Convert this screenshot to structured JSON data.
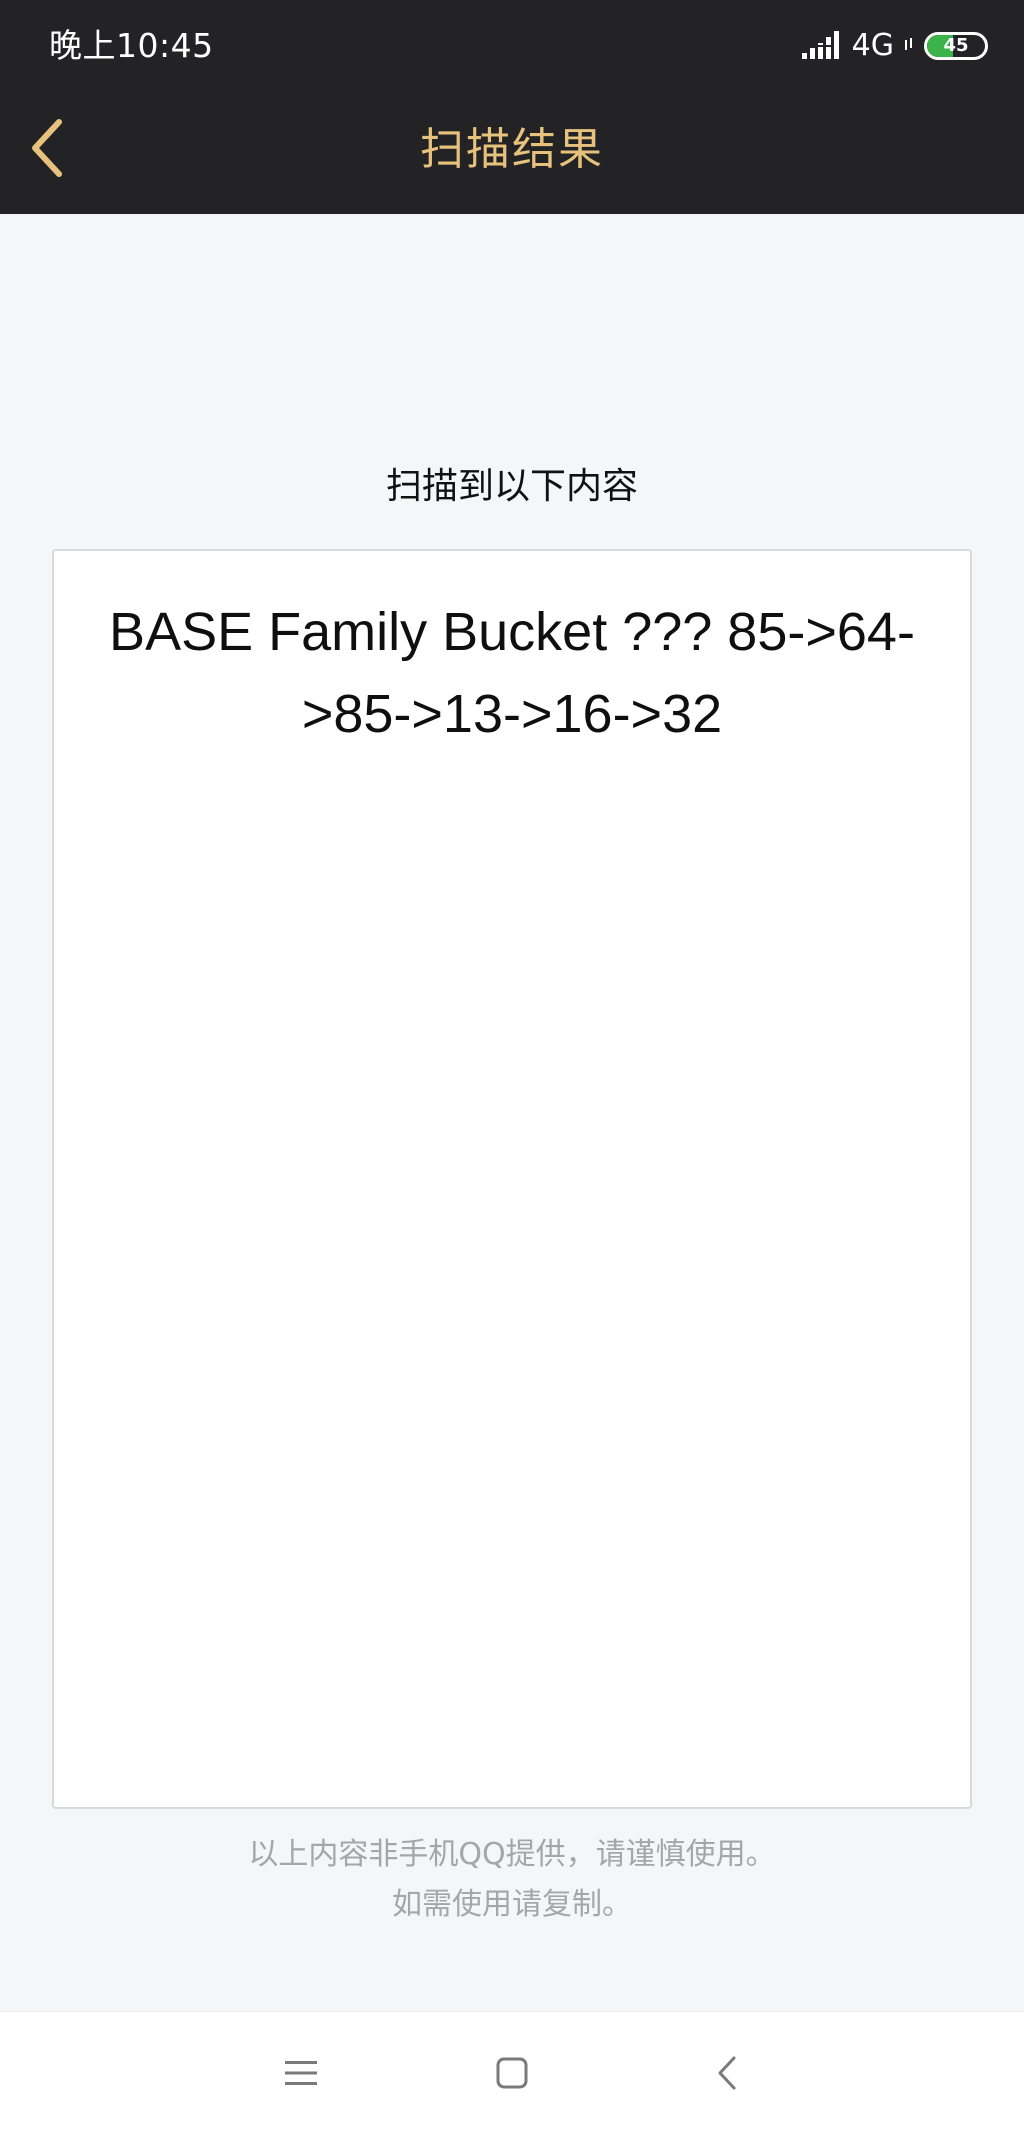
{
  "status_bar": {
    "time": "晚上10:45",
    "network": "4G",
    "battery_level": "45",
    "battery_fraction": 0.45,
    "signal_icon": "signal-icon"
  },
  "header": {
    "title": "扫描结果",
    "back_icon": "chevron-left-icon",
    "title_color": "#e6c27d",
    "background": "#232325"
  },
  "main": {
    "heading": "扫描到以下内容",
    "result_text": "BASE Family Bucket ??? 85->64->85->13->16->32"
  },
  "footer": {
    "notice_line1": "以上内容非手机QQ提供，请谨慎使用。",
    "notice_line2": "如需使用请复制。"
  },
  "system_nav": {
    "menu_icon": "menu-icon",
    "home_icon": "square-home-icon",
    "back_icon": "back-triangle-icon"
  }
}
